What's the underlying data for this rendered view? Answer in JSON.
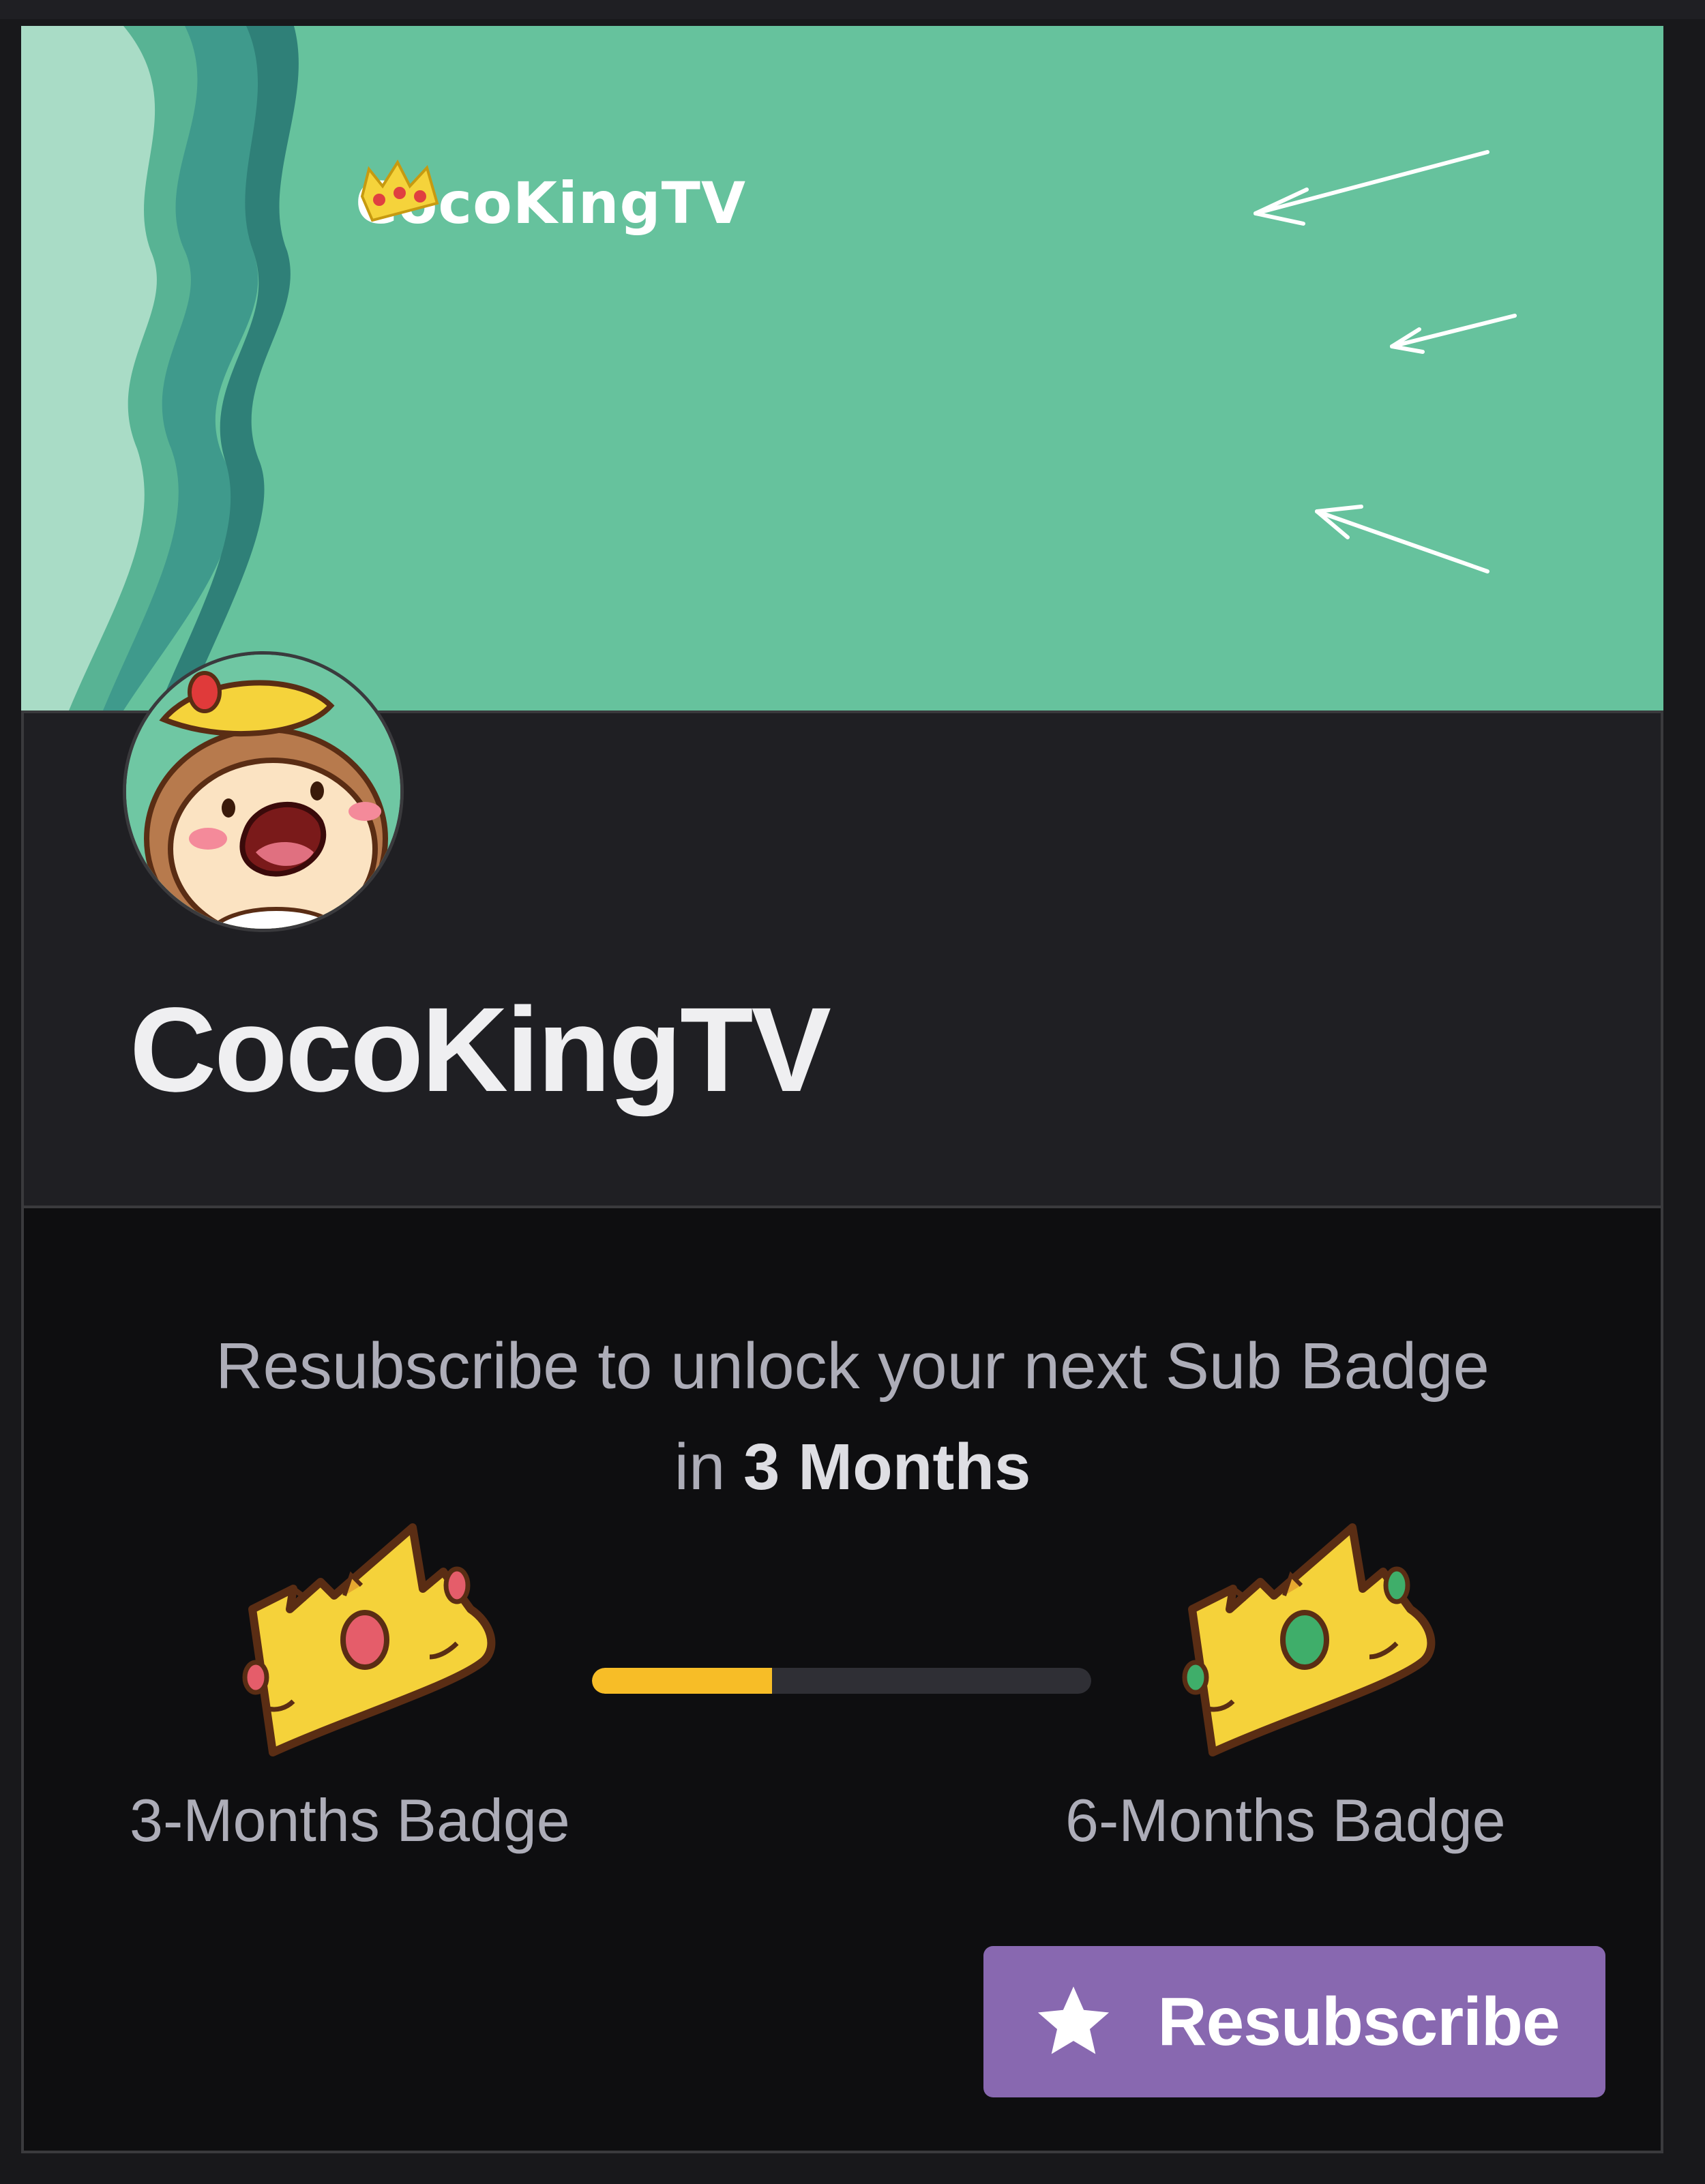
{
  "banner": {
    "logo_text": "CocoKingTV",
    "bg_color": "#66c29d"
  },
  "channel": {
    "name": "CocoKingTV",
    "avatar_icon": "cartoon-king-avatar"
  },
  "promo": {
    "line1": "Resubscribe to unlock your next Sub Badge",
    "prefix": "in",
    "highlight": "3 Months"
  },
  "badges": {
    "current": {
      "label": "3-Months Badge",
      "icon": "crown-red-gems-icon"
    },
    "next": {
      "label": "6-Months Badge",
      "icon": "crown-green-gems-icon"
    },
    "progress": 0.36,
    "progress_color": "#f7bd27"
  },
  "action": {
    "label": "Resubscribe",
    "icon": "star-icon",
    "color": "#8868b0"
  }
}
